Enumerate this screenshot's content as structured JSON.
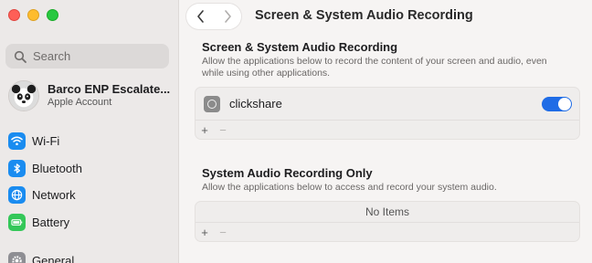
{
  "sidebar": {
    "search_placeholder": "Search",
    "account": {
      "name": "Barco ENP Escalate...",
      "subtitle": "Apple Account"
    },
    "items": [
      {
        "label": "Wi-Fi",
        "icon": "wifi-icon",
        "color": "#1a8cf0"
      },
      {
        "label": "Bluetooth",
        "icon": "bluetooth-icon",
        "color": "#1a8cf0"
      },
      {
        "label": "Network",
        "icon": "globe-icon",
        "color": "#1a8cf0"
      },
      {
        "label": "Battery",
        "icon": "battery-icon",
        "color": "#34c759"
      },
      {
        "label": "General",
        "icon": "gear-icon",
        "color": "#8e8e93"
      }
    ]
  },
  "header": {
    "title": "Screen & System Audio Recording"
  },
  "section1": {
    "title": "Screen & System Audio Recording",
    "description": "Allow the applications below to record the content of your screen and audio, even while using other applications.",
    "apps": [
      {
        "name": "clickshare",
        "enabled": true
      }
    ],
    "add_label": "+",
    "remove_label": "−"
  },
  "section2": {
    "title": "System Audio Recording Only",
    "description": "Allow the applications below to access and record your system audio.",
    "empty_text": "No Items",
    "add_label": "+",
    "remove_label": "−"
  },
  "colors": {
    "accent": "#1f6ce6"
  }
}
